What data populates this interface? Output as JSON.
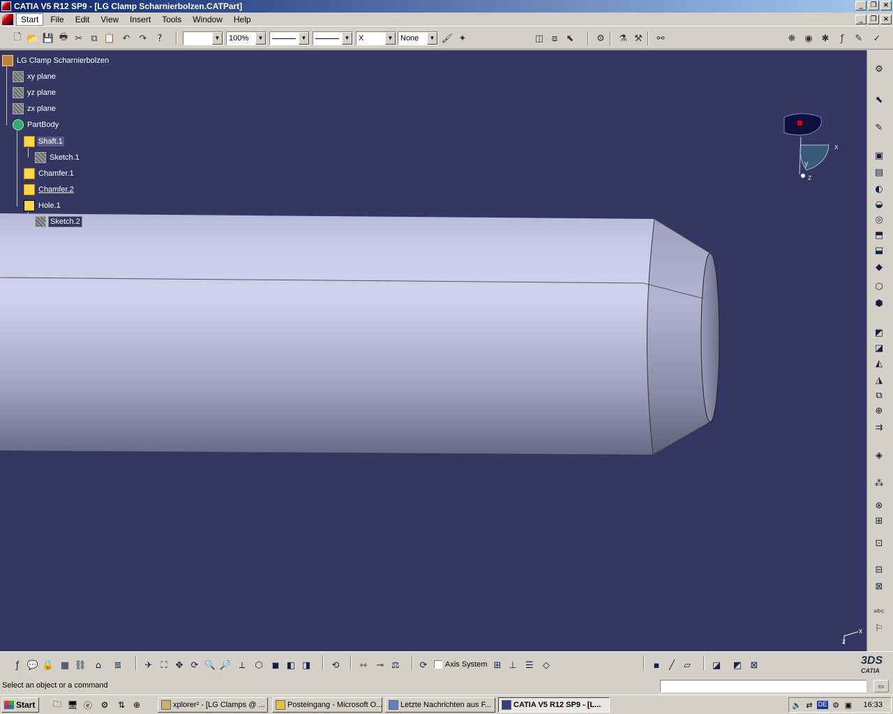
{
  "titlebar": {
    "title": "CATIA V5 R12 SP9 - [LG Clamp Scharnierbolzen.CATPart]"
  },
  "menu": {
    "items": [
      "Start",
      "File",
      "Edit",
      "View",
      "Insert",
      "Tools",
      "Window",
      "Help"
    ]
  },
  "toolbar": {
    "zoom_value": "100%",
    "layer_value": "None",
    "point_style": "X"
  },
  "tree": {
    "root": "LG Clamp Scharnierbolzen",
    "nodes": [
      {
        "label": "xy plane"
      },
      {
        "label": "yz plane"
      },
      {
        "label": "zx plane"
      },
      {
        "label": "PartBody"
      },
      {
        "label": "Shaft.1"
      },
      {
        "label": "Sketch.1"
      },
      {
        "label": "Chamfer.1"
      },
      {
        "label": "Chamfer.2"
      },
      {
        "label": "Hole.1"
      },
      {
        "label": "Sketch.2"
      }
    ]
  },
  "compass": {
    "x": "x",
    "y": "y",
    "z": "z"
  },
  "viewport_axis": {
    "x": "x",
    "z": "z"
  },
  "bottom_toolbar": {
    "axis_system_label": "Axis System",
    "logo": "CATIA",
    "logo_mark": "3DS"
  },
  "status": {
    "prompt": "Select an object or a command"
  },
  "taskbar": {
    "start_label": "Start",
    "tasks": [
      "xplorer² - [LG Clamps @ ...",
      "Posteingang - Microsoft O...",
      "Letzte Nachrichten aus F...",
      "CATIA V5 R12 SP9 - [L..."
    ],
    "tray_lang": "DE",
    "clock": "16:33"
  },
  "colors": {
    "viewport_bg": "#363663",
    "part_body": "#c8c8e8",
    "title_gradient_start": "#0a246a"
  },
  "icons": {
    "window_controls": [
      "minimize-icon",
      "restore-icon",
      "close-icon"
    ]
  }
}
